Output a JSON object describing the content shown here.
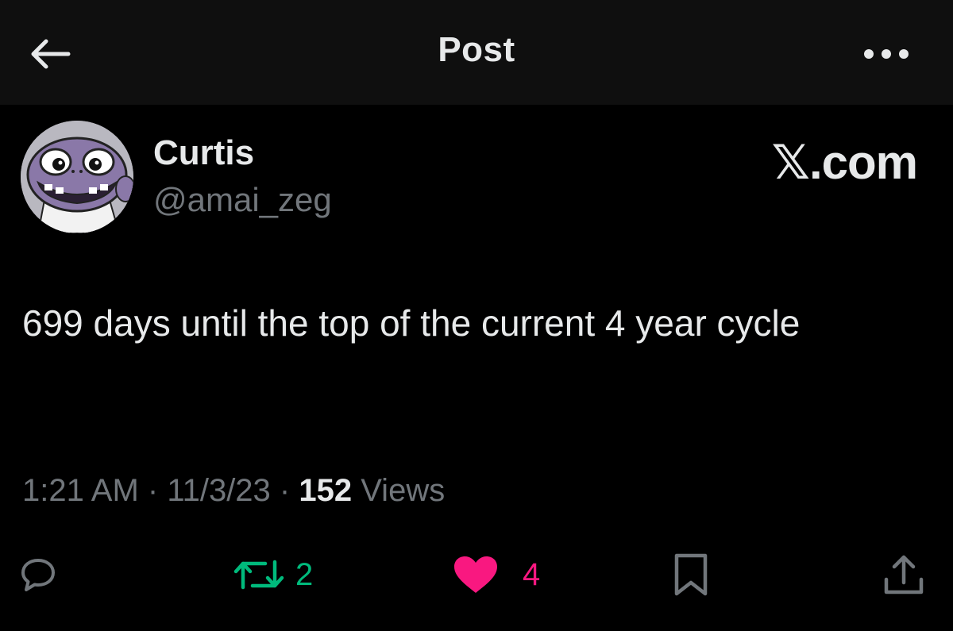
{
  "header": {
    "title": "Post",
    "back_icon": "arrow-left-icon",
    "more_icon": "more-horizontal-icon"
  },
  "author": {
    "display_name": "Curtis",
    "handle": "@amai_zeg",
    "avatar_icon": "cartoon-avatar"
  },
  "watermark": "𝕏.com",
  "post": {
    "text": "699 days until the top of the current 4 year cycle"
  },
  "meta": {
    "time": "1:21 AM",
    "separator": " · ",
    "date": "11/3/23",
    "views_count": "152",
    "views_label": " Views"
  },
  "actions": {
    "reply": {
      "icon": "reply-bubble-icon"
    },
    "retweet": {
      "icon": "retweet-icon",
      "count": "2",
      "color": "#00ba7c"
    },
    "like": {
      "icon": "heart-filled-icon",
      "count": "4",
      "color": "#f91880"
    },
    "bookmark": {
      "icon": "bookmark-icon"
    },
    "share": {
      "icon": "share-icon"
    }
  },
  "colors": {
    "background": "#000000",
    "header_background": "#0f0f0f",
    "primary_text": "#e7e9ea",
    "secondary_text": "#71767b"
  }
}
